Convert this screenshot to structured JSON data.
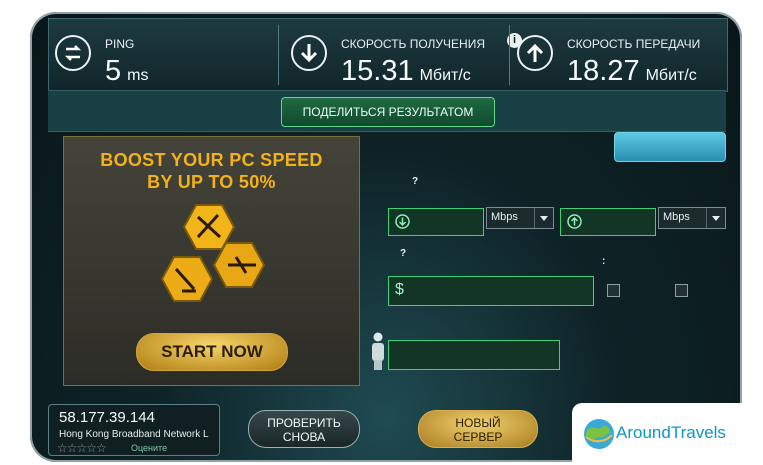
{
  "ping": {
    "label": "PING",
    "value": "5",
    "unit": "ms"
  },
  "download": {
    "label": "СКОРОСТЬ ПОЛУЧЕНИЯ",
    "value": "15.31",
    "unit": "Мбит/с"
  },
  "upload": {
    "label": "СКОРОСТЬ ПЕРЕДАЧИ",
    "value": "18.27",
    "unit": "Мбит/с"
  },
  "share_label": "ПОДЕЛИТЬСЯ РЕЗУЛЬТАТОМ",
  "info_glyph": "i",
  "ad": {
    "headline_1": "BOOST YOUR PC SPEED",
    "headline_2": "BY UP TO 50%",
    "cta": "START NOW"
  },
  "form": {
    "q1": "?",
    "q2": "?",
    "q3": ":",
    "dl_unit": "Mbps",
    "ul_unit": "Mbps",
    "currency": "$"
  },
  "server": {
    "ip": "58.177.39.144",
    "isp": "Hong Kong Broadband Network L",
    "stars": "☆☆☆☆☆",
    "rate_label": "Оцените"
  },
  "buttons": {
    "retest_1": "ПРОВЕРИТЬ",
    "retest_2": "СНОВА",
    "new_1": "НОВЫЙ",
    "new_2": "СЕРВЕР"
  },
  "watermark": {
    "text": "AroundTravels"
  },
  "colors": {
    "accent_green": "#3fd07a",
    "gold": "#f3b11b",
    "frame": "#0e2327"
  }
}
